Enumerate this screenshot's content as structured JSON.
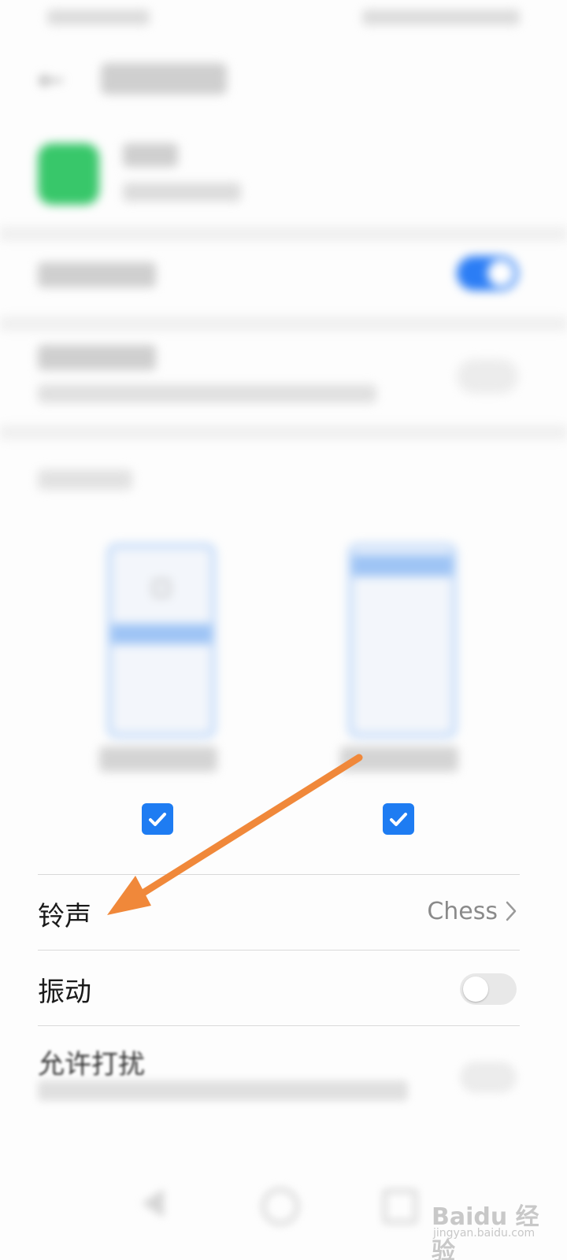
{
  "settings": {
    "ringtone_label": "铃声",
    "ringtone_value": "Chess",
    "vibrate_label": "振动",
    "vibrate_on": false,
    "dnd_label": "允许打扰"
  },
  "checkboxes": [
    {
      "checked": true
    },
    {
      "checked": true
    }
  ],
  "watermark": {
    "text": "Baidu 经验",
    "sub": "jingyan.baidu.com"
  },
  "colors": {
    "accent": "#1e7cf2",
    "arrow": "#f0883a"
  }
}
